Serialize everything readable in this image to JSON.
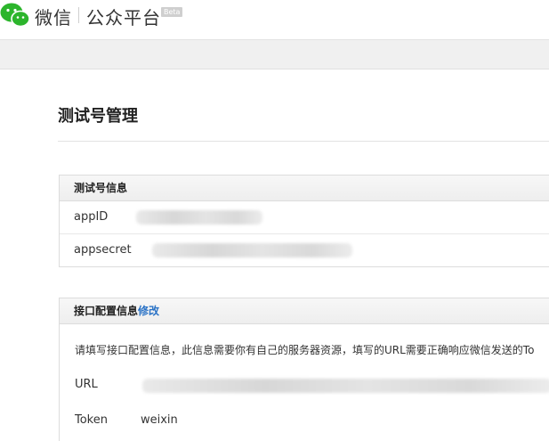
{
  "header": {
    "brand_name": "微信",
    "product_name": "公众平台",
    "badge": "Beta"
  },
  "page": {
    "title": "测试号管理"
  },
  "test_account_panel": {
    "title": "测试号信息",
    "rows": [
      {
        "label": "appID",
        "value": ""
      },
      {
        "label": "appsecret",
        "value": ""
      }
    ]
  },
  "interface_panel": {
    "title": "接口配置信息",
    "edit_label": "修改",
    "description": "请填写接口配置信息，此信息需要你有自己的服务器资源，填写的URL需要正确响应微信发送的To",
    "url_label": "URL",
    "url_value": "",
    "token_label": "Token",
    "token_value": "weixin"
  },
  "colors": {
    "brand_green": "#2cb52c",
    "link_blue": "#2b73c6",
    "nav_gray": "#f0f0f0"
  }
}
